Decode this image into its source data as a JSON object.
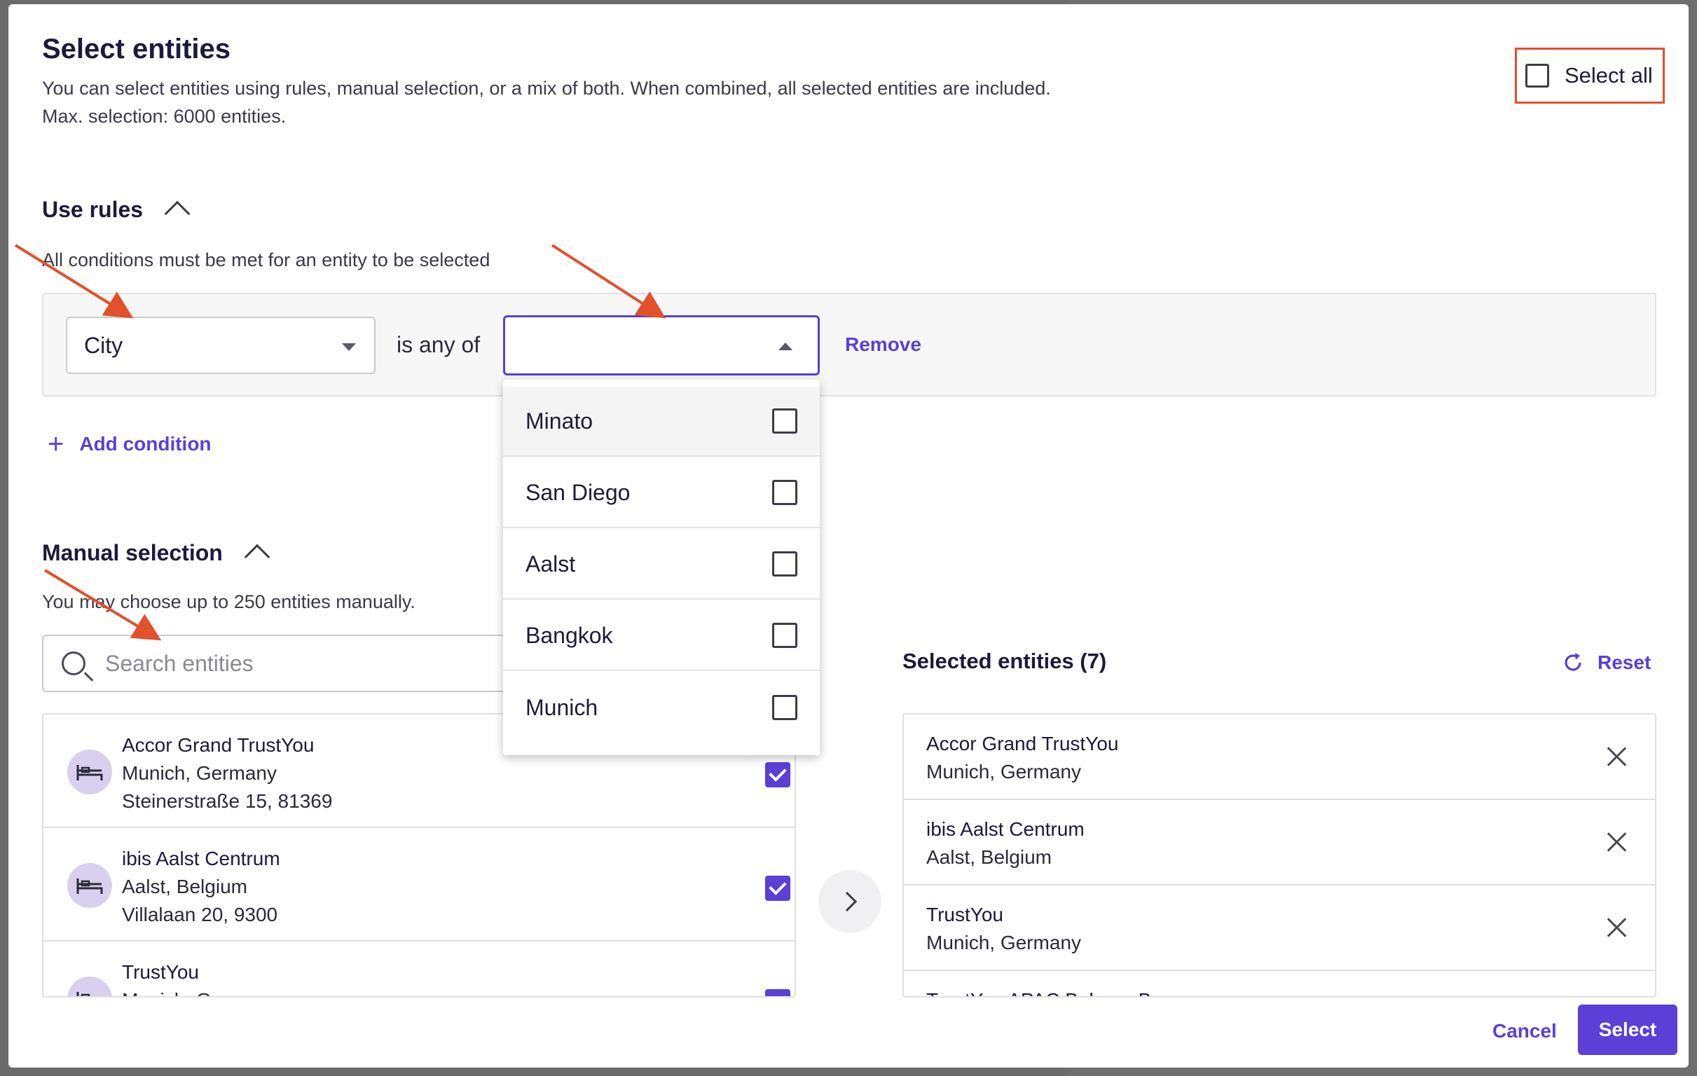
{
  "modal": {
    "title": "Select entities",
    "description_line1": "You can select entities using rules, manual selection, or a mix of both. When combined, all selected entities are included.",
    "description_line2": "Max. selection: 6000 entities.",
    "select_all_label": "Select all"
  },
  "rules": {
    "heading": "Use rules",
    "subtitle": "All conditions must be met for an entity to be selected",
    "condition": {
      "field_value": "City",
      "operator": "is any of",
      "value_placeholder": "",
      "remove_label": "Remove"
    },
    "add_condition_label": "Add condition",
    "dropdown_options": [
      {
        "label": "Minato",
        "checked": false
      },
      {
        "label": "San Diego",
        "checked": false
      },
      {
        "label": "Aalst",
        "checked": false
      },
      {
        "label": "Bangkok",
        "checked": false
      },
      {
        "label": "Munich",
        "checked": false
      }
    ]
  },
  "manual": {
    "heading": "Manual selection",
    "subtitle": "You may choose up to 250 entities manually.",
    "search_placeholder": "Search entities",
    "entities": [
      {
        "name": "Accor Grand TrustYou",
        "location": "Munich, Germany",
        "address": "Steinerstraße 15, 81369",
        "checked": true
      },
      {
        "name": "ibis Aalst Centrum",
        "location": "Aalst, Belgium",
        "address": "Villalaan 20, 9300",
        "checked": true
      },
      {
        "name": "TrustYou",
        "location": "Munich, Germany",
        "address": "",
        "checked": true
      }
    ]
  },
  "selected": {
    "heading": "Selected entities (7)",
    "reset_label": "Reset",
    "items": [
      {
        "name": "Accor Grand TrustYou",
        "location": "Munich, Germany"
      },
      {
        "name": "ibis Aalst Centrum",
        "location": "Aalst, Belgium"
      },
      {
        "name": "TrustYou",
        "location": "Munich, Germany"
      },
      {
        "name": "TrustYou APAC Bahnen B",
        "location": ""
      }
    ]
  },
  "footer": {
    "cancel_label": "Cancel",
    "select_label": "Select"
  },
  "colors": {
    "accent": "#5b3fd6",
    "annotation": "#e2502c"
  },
  "icons": {
    "hotel": "bed-icon",
    "reset": "refresh-icon",
    "remove": "close-icon",
    "move": "chevron-right-icon"
  }
}
